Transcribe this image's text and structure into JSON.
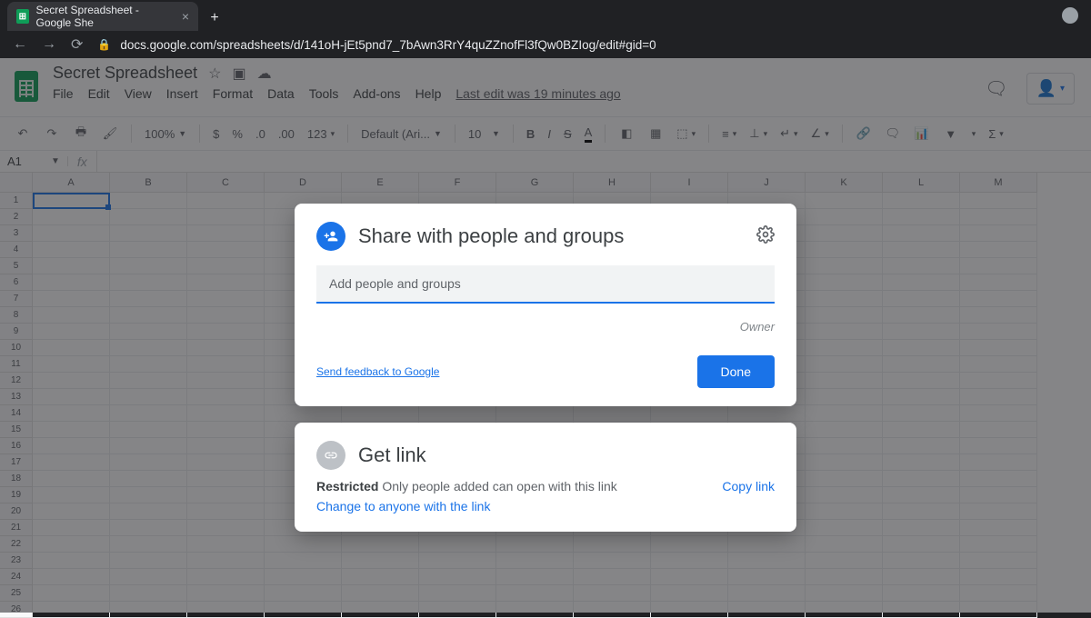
{
  "browser": {
    "tab_title": "Secret Spreadsheet - Google She",
    "url": "docs.google.com/spreadsheets/d/141oH-jEt5pnd7_7bAwn3RrY4quZZnofFl3fQw0BZIog/edit#gid=0"
  },
  "doc": {
    "title": "Secret Spreadsheet",
    "menus": [
      "File",
      "Edit",
      "View",
      "Insert",
      "Format",
      "Data",
      "Tools",
      "Add-ons",
      "Help"
    ],
    "last_edit": "Last edit was 19 minutes ago"
  },
  "toolbar": {
    "zoom": "100%",
    "currency": "$",
    "percent": "%",
    "dec_dec": ".0",
    "inc_dec": ".00",
    "num_fmt": "123",
    "font": "Default (Ari...",
    "font_size": "10",
    "bold": "B",
    "italic": "I",
    "strike": "S",
    "text_color": "A"
  },
  "namebox": {
    "ref": "A1",
    "fx": "fx"
  },
  "grid": {
    "cols": [
      "A",
      "B",
      "C",
      "D",
      "E",
      "F",
      "G",
      "H",
      "I",
      "J",
      "K",
      "L",
      "M"
    ],
    "rows": [
      "1",
      "2",
      "3",
      "4",
      "5",
      "6",
      "7",
      "8",
      "9",
      "10",
      "11",
      "12",
      "13",
      "14",
      "15",
      "16",
      "17",
      "18",
      "19",
      "20",
      "21",
      "22",
      "23",
      "24",
      "25",
      "26"
    ]
  },
  "share_modal": {
    "title": "Share with people and groups",
    "placeholder": "Add people and groups",
    "owner_label": "Owner",
    "feedback": "Send feedback to Google",
    "done": "Done"
  },
  "link_modal": {
    "title": "Get link",
    "restricted": "Restricted",
    "restricted_desc": " Only people added can open with this link",
    "change": "Change to anyone with the link",
    "copy": "Copy link"
  }
}
